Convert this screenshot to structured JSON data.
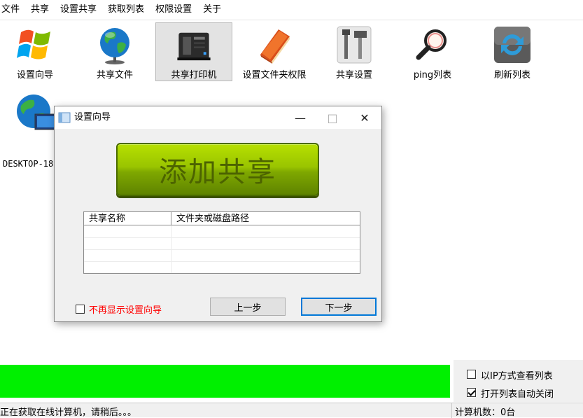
{
  "menu": [
    "文件",
    "共享",
    "设置共享",
    "获取列表",
    "权限设置",
    "关于"
  ],
  "toolbar": [
    {
      "label": "设置向导",
      "icon": "windows-logo-icon"
    },
    {
      "label": "共享文件",
      "icon": "globe-icon"
    },
    {
      "label": "共享打印机",
      "icon": "printer-icon"
    },
    {
      "label": "设置文件夹权限",
      "icon": "folder-book-icon"
    },
    {
      "label": "共享设置",
      "icon": "tools-icon"
    },
    {
      "label": "ping列表",
      "icon": "magnifier-icon"
    },
    {
      "label": "刷新列表",
      "icon": "refresh-icon"
    }
  ],
  "computers": [
    {
      "name": "DESKTOP-18"
    }
  ],
  "dialog": {
    "title": "设置向导",
    "add_share_label": "添加共享",
    "columns": [
      "共享名称",
      "文件夹或磁盘路径"
    ],
    "dont_show_label": "不再显示设置向导",
    "dont_show_checked": false,
    "prev_label": "上一步",
    "next_label": "下一步",
    "window_buttons": {
      "minimize": "—",
      "maximize": "□",
      "close": "✕"
    }
  },
  "options": {
    "view_by_ip_label": "以IP方式查看列表",
    "view_by_ip_checked": false,
    "auto_close_label": "打开列表自动关闭",
    "auto_close_checked": true
  },
  "status": {
    "message": "正在获取在线计算机，请稍后。。。",
    "count": "计算机数：0台"
  },
  "colors": {
    "progress": "#00f000",
    "add_share_button": "#8fb800",
    "warning_text": "#ff0000"
  }
}
